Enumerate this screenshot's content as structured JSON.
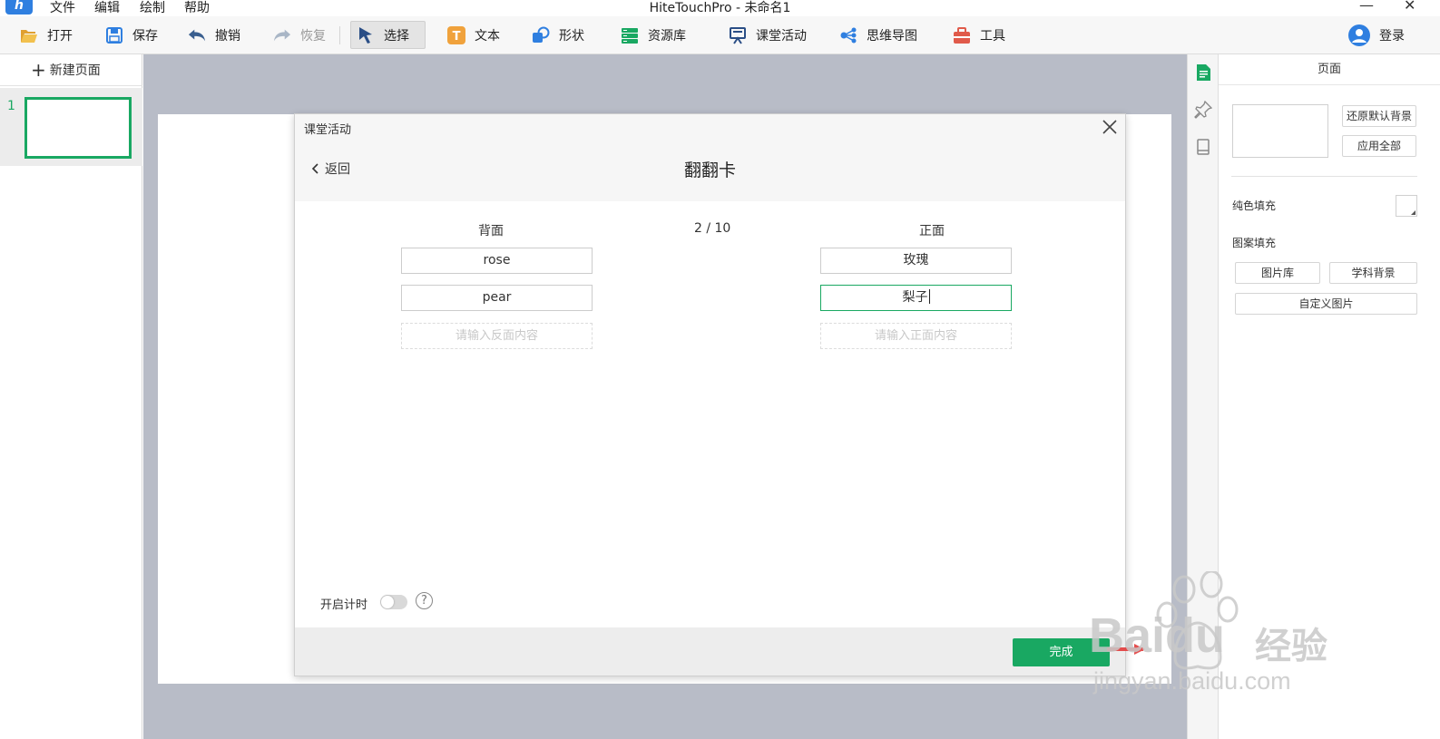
{
  "window": {
    "title": "HiteTouchPro - 未命名1",
    "minimize": "—",
    "close": "✕"
  },
  "menubar": {
    "items": [
      "文件",
      "编辑",
      "绘制",
      "帮助"
    ]
  },
  "toolbar": {
    "open": "打开",
    "save": "保存",
    "undo": "撤销",
    "redo": "恢复",
    "select": "选择",
    "text": "文本",
    "shape": "形状",
    "resources": "资源库",
    "class_activity": "课堂活动",
    "mind_map": "思维导图",
    "tools": "工具",
    "login": "登录",
    "text_icon_glyph": "T",
    "colors": {
      "accent_icon": "#2f7fe0",
      "open_icon": "#e0a030",
      "text_icon": "#f0a23c",
      "resources_icon": "#19a862",
      "tools_icon": "#e05a4a"
    }
  },
  "pages": {
    "new_page_label": "新建页面",
    "list": [
      {
        "number": "1"
      }
    ]
  },
  "dialog": {
    "caption": "课堂活动",
    "back_label": "返回",
    "title": "翻翻卡",
    "back_header": "背面",
    "front_header": "正面",
    "counter": "2 / 10",
    "cards": [
      {
        "back": "rose",
        "front": "玫瑰"
      },
      {
        "back": "pear",
        "front": "梨子"
      }
    ],
    "back_placeholder": "请输入反面内容",
    "front_placeholder": "请输入正面内容",
    "timer_label": "开启计时",
    "timer_enabled": false,
    "help_glyph": "?",
    "done_label": "完成",
    "accent_color": "#19a862"
  },
  "right_panel": {
    "title": "页面",
    "restore_default_bg": "还原默认背景",
    "apply_all": "应用全部",
    "solid_fill_label": "纯色填充",
    "pattern_fill_label": "图案填充",
    "image_library": "图片库",
    "subject_background": "学科背景",
    "custom_image": "自定义图片",
    "fill_color": "#ffffff"
  },
  "watermark": {
    "brand": "Baidu",
    "brand_suffix": "经验",
    "url": "jingyan.baidu.com"
  }
}
